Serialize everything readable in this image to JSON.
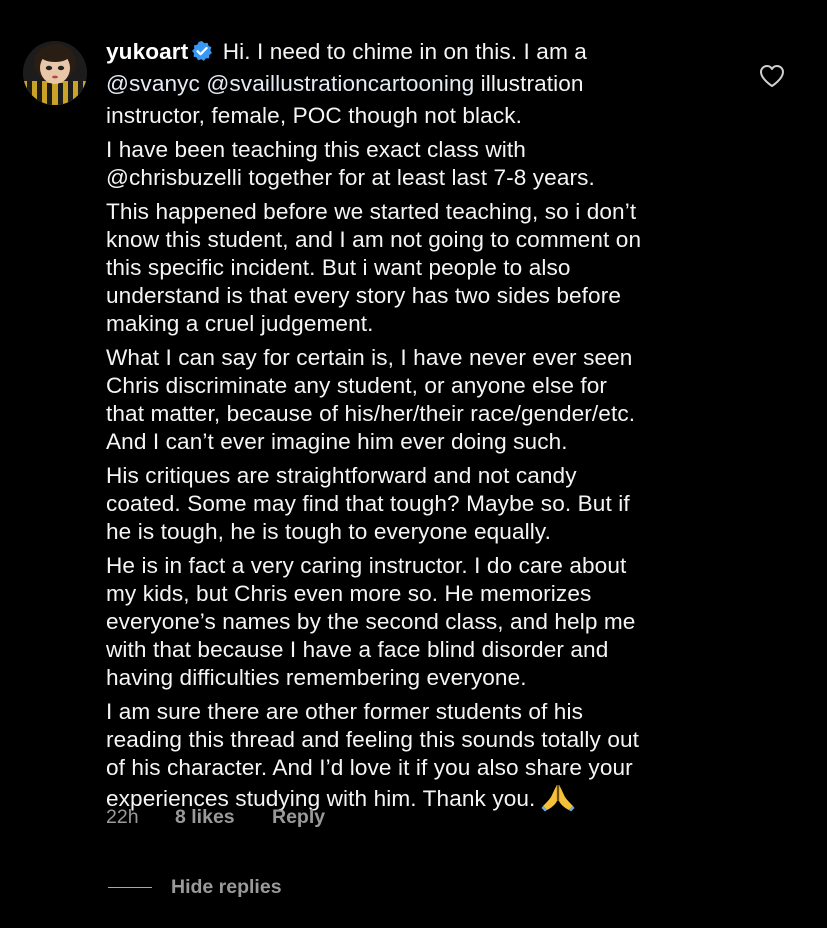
{
  "comment": {
    "username": "yukoart",
    "verified": true,
    "first_line_text": " Hi. I need to chime in on this. I am a",
    "mentions_line": {
      "mention1": "@svanyc",
      "mention2": "@svaillustrationcartooning",
      "suffix": " illustration"
    },
    "line3": "instructor, female, POC though not black.",
    "paragraphs": [
      [
        "I have been teaching this exact class with",
        "@chrisbuzelli together for at least last 7-8 years."
      ],
      [
        "This happened before we started teaching, so i don’t",
        "know this student, and I am not going to comment on",
        "this specific incident. But i want people to also",
        "understand is that every story has two sides before",
        "making a cruel judgement."
      ],
      [
        "What I can say for certain is, I have never ever seen",
        "Chris discriminate any student, or anyone else for",
        "that matter, because of his/her/their race/gender/etc.",
        "And I can’t ever imagine him ever doing such."
      ],
      [
        "His critiques are straightforward and not candy",
        "coated. Some may find that tough? Maybe so. But if",
        "he is tough, he is tough to everyone equally."
      ],
      [
        "He is in fact a very caring instructor. I do care about",
        "my kids, but Chris even more so. He memorizes",
        "everyone’s names by the second class, and help me",
        "with that because I have a face blind disorder and",
        "having difficulties remembering everyone."
      ]
    ],
    "last_paragraph": [
      "I am sure there are other former students of his",
      "reading this thread and feeling this sounds totally out",
      "of his character. And I’d love it if you also share your"
    ],
    "closing_line": "experiences studying with him. Thank you.",
    "emoji": "folded-hands",
    "time": "22h",
    "likes": "8 likes",
    "reply_label": "Reply",
    "hide_replies_label": "Hide replies",
    "like_icon": "heart-outline-icon"
  },
  "colors": {
    "background": "#000000",
    "text": "#f5f5f5",
    "meta": "#9a9a9a",
    "verified": "#3897f0"
  }
}
